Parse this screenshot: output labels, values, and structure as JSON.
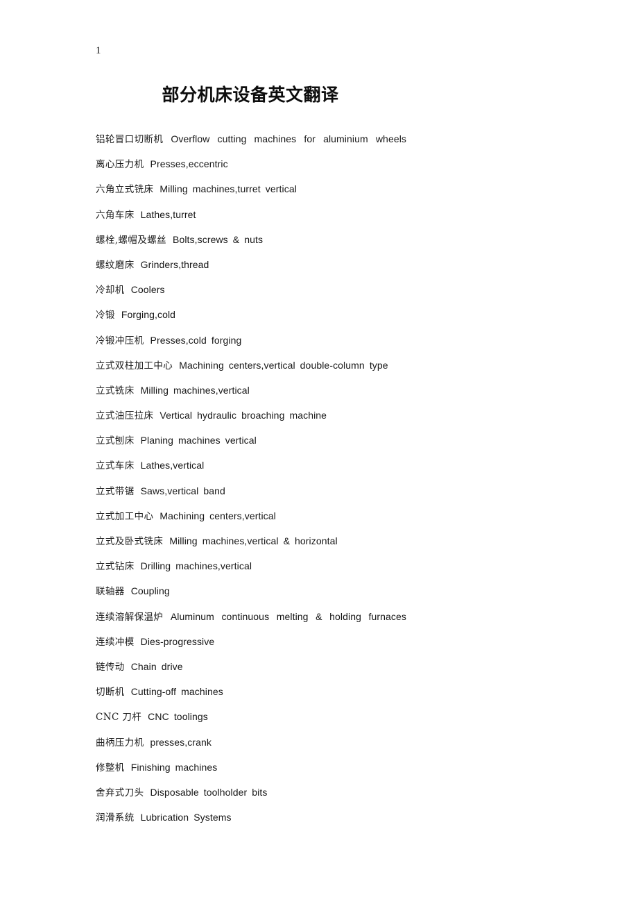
{
  "page": {
    "marker": "1",
    "title": "部分机床设备英文翻译",
    "background_color": "#ffffff",
    "text_color": "#1a1a1a"
  },
  "entries": [
    {
      "zh": "铝轮冒口切断机",
      "en": [
        "Overflow",
        "cutting",
        "machines",
        "for",
        "aluminium",
        "wheels"
      ],
      "justified": true
    },
    {
      "zh": "离心压力机",
      "en": [
        "Presses,eccentric"
      ],
      "justified": false
    },
    {
      "zh": "六角立式铣床",
      "en": [
        "Milling",
        "machines,turret",
        "vertical"
      ],
      "justified": false
    },
    {
      "zh": "六角车床",
      "en": [
        "Lathes,turret"
      ],
      "justified": false
    },
    {
      "zh": "螺栓,螺帽及螺丝",
      "en": [
        "Bolts,screws",
        "&",
        "nuts"
      ],
      "justified": false
    },
    {
      "zh": "螺纹磨床",
      "en": [
        "Grinders,thread"
      ],
      "justified": false
    },
    {
      "zh": "冷却机",
      "en": [
        "Coolers"
      ],
      "justified": false
    },
    {
      "zh": "冷锻",
      "en": [
        "Forging,cold"
      ],
      "justified": false
    },
    {
      "zh": "冷锻冲压机",
      "en": [
        "Presses,cold",
        "forging"
      ],
      "justified": false
    },
    {
      "zh": "立式双柱加工中心",
      "en": [
        "Machining",
        "centers,vertical",
        "double-column",
        "type"
      ],
      "justified": false
    },
    {
      "zh": "立式铣床",
      "en": [
        "Milling",
        "machines,vertical"
      ],
      "justified": false
    },
    {
      "zh": "立式油压拉床",
      "en": [
        "Vertical",
        "hydraulic",
        "broaching",
        "machine"
      ],
      "justified": false
    },
    {
      "zh": "立式刨床",
      "en": [
        "Planing",
        "machines",
        "vertical"
      ],
      "justified": false
    },
    {
      "zh": "立式车床",
      "en": [
        "Lathes,vertical"
      ],
      "justified": false
    },
    {
      "zh": "立式带锯",
      "en": [
        "Saws,vertical",
        "band"
      ],
      "justified": false
    },
    {
      "zh": "立式加工中心",
      "en": [
        "Machining",
        "centers,vertical"
      ],
      "justified": false
    },
    {
      "zh": "立式及卧式铣床",
      "en": [
        "Milling",
        "machines,vertical",
        "&",
        "horizontal"
      ],
      "justified": false
    },
    {
      "zh": "立式钻床",
      "en": [
        "Drilling",
        "machines,vertical"
      ],
      "justified": false
    },
    {
      "zh": "联轴器",
      "en": [
        "Coupling"
      ],
      "justified": false
    },
    {
      "zh": "连续溶解保温炉",
      "en": [
        "Aluminum",
        "continuous",
        "melting",
        "&",
        "holding",
        "furnaces"
      ],
      "justified": true
    },
    {
      "zh": "连续冲模",
      "en": [
        "Dies-progressive"
      ],
      "justified": false
    },
    {
      "zh": "链传动",
      "en": [
        "Chain",
        "drive"
      ],
      "justified": false
    },
    {
      "zh": "切断机",
      "en": [
        "Cutting-off",
        "machines"
      ],
      "justified": false
    },
    {
      "zh": "CNC 刀杆",
      "en": [
        "CNC",
        "toolings"
      ],
      "justified": false
    },
    {
      "zh": "曲柄压力机",
      "en": [
        "presses,crank"
      ],
      "justified": false
    },
    {
      "zh": "修整机",
      "en": [
        "Finishing",
        "machines"
      ],
      "justified": false
    },
    {
      "zh": "舍弃式刀头",
      "en": [
        "Disposable",
        "toolholder",
        "bits"
      ],
      "justified": false
    },
    {
      "zh": "润滑系统",
      "en": [
        "Lubrication",
        "Systems"
      ],
      "justified": false
    }
  ]
}
